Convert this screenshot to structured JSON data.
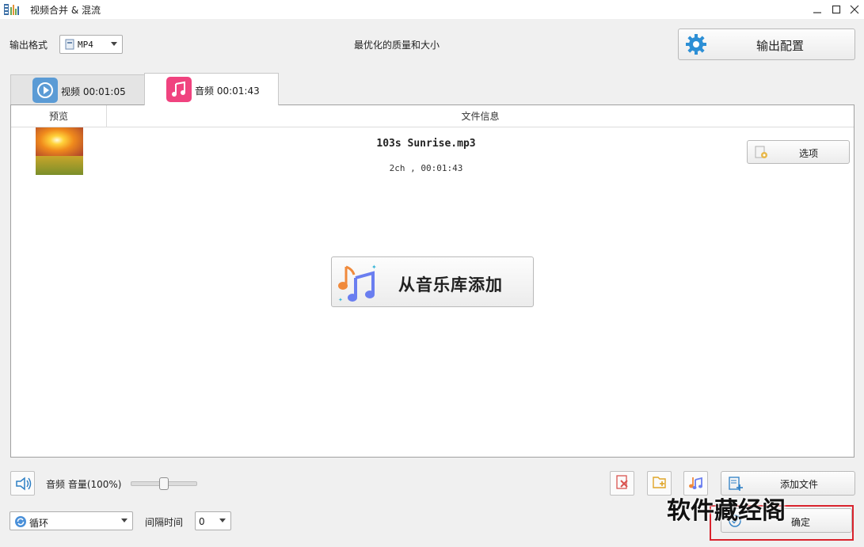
{
  "window": {
    "title": "视频合并 & 混流",
    "minimize_icon": "minimize-icon",
    "maximize_icon": "maximize-icon",
    "close_icon": "close-icon"
  },
  "toolbar": {
    "output_format_label": "输出格式",
    "output_format_value": "MP4",
    "quality_text": "最优化的质量和大小",
    "output_config_label": "输出配置"
  },
  "tabs": [
    {
      "label": "视频 00:01:05",
      "icon": "play-icon",
      "active": false
    },
    {
      "label": "音频 00:01:43",
      "icon": "music-note-icon",
      "active": true
    }
  ],
  "table": {
    "headers": [
      "预览",
      "文件信息"
    ],
    "rows": [
      {
        "filename": "103s Sunrise.mp3",
        "meta": "2ch , 00:01:43",
        "options_label": "选项"
      }
    ]
  },
  "add_from_library_label": "从音乐库添加",
  "bottom": {
    "volume_label": "音频 音量(100%)",
    "volume_value": 100,
    "loop_value": "循环",
    "interval_label": "间隔时间",
    "interval_value": "0",
    "add_file_label": "添加文件",
    "ok_label": "确定"
  },
  "watermark": "软件藏经阁",
  "colors": {
    "video_tab_icon": "#5b9bd5",
    "audio_tab_icon": "#f0437f",
    "highlight_box": "#d9232d",
    "gear": "#2d8fd5"
  }
}
